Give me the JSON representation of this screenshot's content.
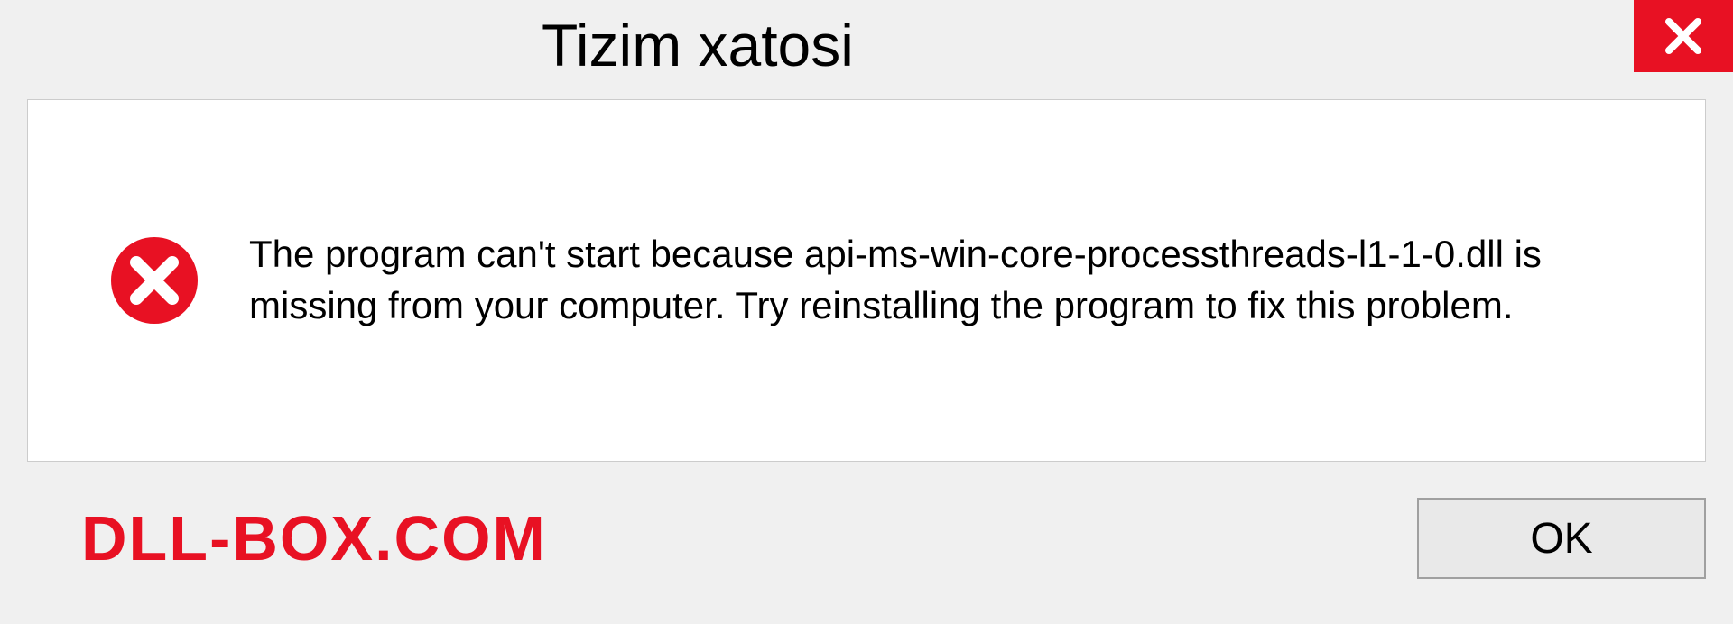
{
  "dialog": {
    "title": "Tizim xatosi",
    "message": "The program can't start because api-ms-win-core-processthreads-l1-1-0.dll is missing from your computer. Try reinstalling the program to fix this problem.",
    "ok_label": "OK"
  },
  "watermark": "DLL-BOX.COM"
}
